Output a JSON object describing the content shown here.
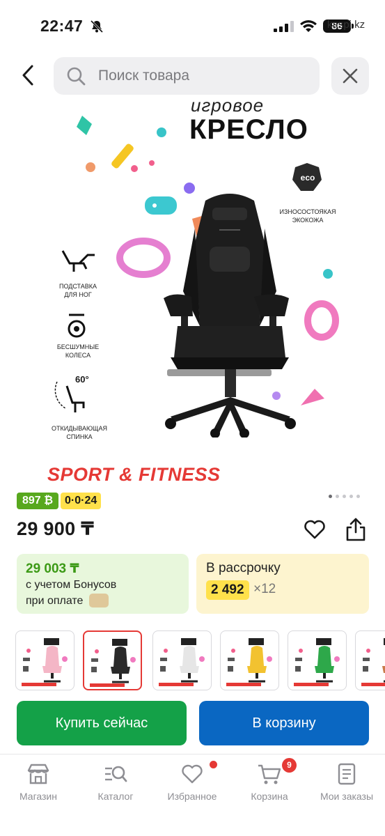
{
  "status_bar": {
    "time": "22:47",
    "battery": "86",
    "watermark": "kaspi.kz"
  },
  "header": {
    "search_placeholder": "Поиск товара"
  },
  "product_image": {
    "title_line1": "игровое",
    "title_line2": "КРЕСЛО",
    "features": [
      {
        "icon": "footrest-icon",
        "label_line1": "ПОДСТАВКА",
        "label_line2": "ДЛЯ НОГ"
      },
      {
        "icon": "wheel-icon",
        "label_line1": "БЕСШУМНЫЕ",
        "label_line2": "КОЛЕСА"
      },
      {
        "icon": "recline-icon",
        "label_line1": "ОТКИДЫВАЮЩАЯ",
        "label_line2": "СПИНКА"
      }
    ],
    "recline_angle": "60°",
    "eco_badge": "eco",
    "eco_label_line1": "ИЗНОСОСТОЯКАЯ",
    "eco_label_line2": "ЭКОКОЖА",
    "brand": "SPORT & FITNESS",
    "carousel_dots": 5,
    "active_dot": 1
  },
  "badges": {
    "price_badge": "897 ₿",
    "installment_badge": "0·0·24",
    "price_badge_color": "#58a81e",
    "installment_badge_color": "#ffe14b"
  },
  "price": {
    "main": "29 900 ₸"
  },
  "bonus_card": {
    "price": "29 003 ₸",
    "line1": "с учетом Бонусов",
    "line2": "при оплате"
  },
  "installment_card": {
    "title": "В рассрочку",
    "amount": "2 492",
    "multiplier": "×12"
  },
  "thumbnails": [
    {
      "color": "#f4b6c6",
      "selected": false
    },
    {
      "color": "#2a2a2a",
      "selected": true
    },
    {
      "color": "#e6e6e6",
      "selected": false
    },
    {
      "color": "#f2c230",
      "selected": false
    },
    {
      "color": "#2ea84a",
      "selected": false
    },
    {
      "color": "#c97a4a",
      "selected": false
    }
  ],
  "actions": {
    "buy_now": "Купить сейчас",
    "add_to_cart": "В корзину",
    "buy_color": "#14a148",
    "cart_color": "#0a67c2"
  },
  "tab_bar": {
    "items": [
      {
        "label": "Магазин",
        "icon": "store-icon"
      },
      {
        "label": "Каталог",
        "icon": "catalog-search-icon"
      },
      {
        "label": "Избранное",
        "icon": "heart-icon"
      },
      {
        "label": "Корзина",
        "icon": "cart-icon",
        "badge": "9"
      },
      {
        "label": "Мои заказы",
        "icon": "orders-icon"
      }
    ]
  }
}
